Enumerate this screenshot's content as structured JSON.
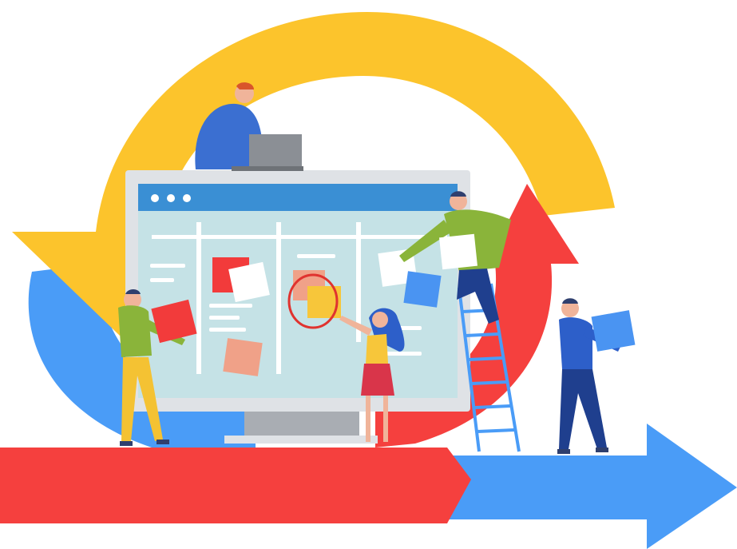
{
  "illustration": {
    "subject": "agile-scrum-workflow",
    "colors": {
      "background": "#ffffff",
      "yellow_arrow": "#fcc42c",
      "red_arrow": "#f5403e",
      "blue_arrow": "#4a9cf7",
      "monitor_frame": "#dfe2e6",
      "monitor_screen": "#c5e2e6",
      "screen_header": "#3a8fd4",
      "sticky_red": "#f23b3b",
      "sticky_white": "#ffffff",
      "sticky_peach": "#f0a188",
      "sticky_yellow": "#f7c63a",
      "sticky_blue": "#4a94f2",
      "ladder": "#4a9cf7",
      "laptop": "#8b8f95"
    },
    "browser_dots": 3,
    "people_count": 5,
    "sticky_notes_count": 9
  }
}
